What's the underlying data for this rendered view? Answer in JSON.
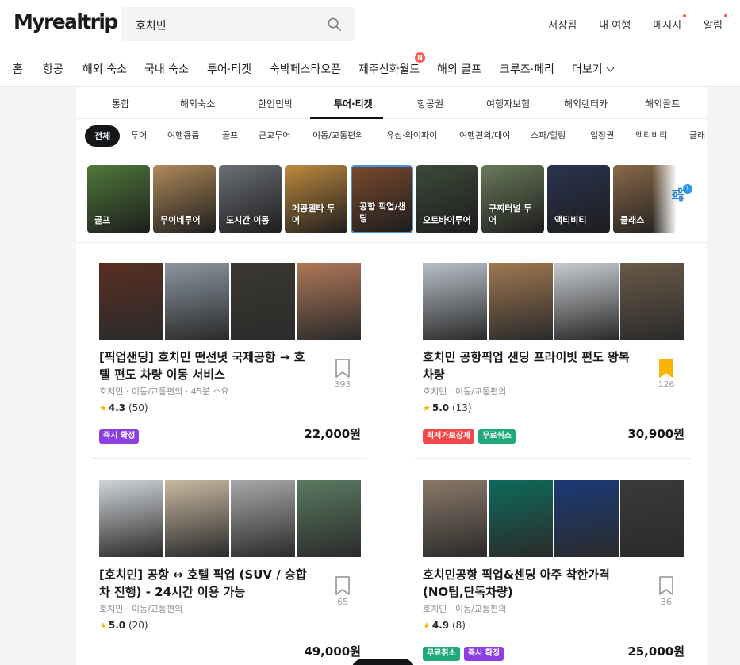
{
  "brand": {
    "logo": "Myrealtrip"
  },
  "search": {
    "value": "호치민"
  },
  "top_links": [
    {
      "label": "저장됨",
      "dot": false
    },
    {
      "label": "내 여행",
      "dot": false
    },
    {
      "label": "메시지",
      "dot": true
    },
    {
      "label": "알림",
      "dot": true
    }
  ],
  "main_nav": [
    {
      "label": "홈"
    },
    {
      "label": "항공"
    },
    {
      "label": "해외 숙소"
    },
    {
      "label": "국내 숙소"
    },
    {
      "label": "투어·티켓"
    },
    {
      "label": "숙박페스타오픈"
    },
    {
      "label": "제주신화월드",
      "badge": "N"
    },
    {
      "label": "해외 골프"
    },
    {
      "label": "크루즈·페리"
    },
    {
      "label": "더보기"
    }
  ],
  "category_tabs": [
    {
      "label": "통합"
    },
    {
      "label": "해외숙소"
    },
    {
      "label": "한인민박"
    },
    {
      "label": "투어·티켓",
      "active": true
    },
    {
      "label": "항공권"
    },
    {
      "label": "여행자보험"
    },
    {
      "label": "해외렌터카"
    },
    {
      "label": "해외골프"
    }
  ],
  "chips": [
    {
      "label": "전체",
      "active": true
    },
    {
      "label": "투어"
    },
    {
      "label": "여행용품"
    },
    {
      "label": "골프"
    },
    {
      "label": "근교투어"
    },
    {
      "label": "이동/교통편의"
    },
    {
      "label": "유심·와이파이"
    },
    {
      "label": "여행편의/대여"
    },
    {
      "label": "스파/힐링"
    },
    {
      "label": "입장권"
    },
    {
      "label": "액티비티"
    },
    {
      "label": "클래"
    }
  ],
  "thumbnails": [
    {
      "label": "골프",
      "color": "#4f7a3a"
    },
    {
      "label": "무이네투어",
      "color": "#b08a5a"
    },
    {
      "label": "도시간 이동",
      "color": "#6b6f75"
    },
    {
      "label": "메콩델타 투어",
      "color": "#c08a3e"
    },
    {
      "label": "공항 픽업/샌딩",
      "color": "#7a4a2e",
      "selected": true
    },
    {
      "label": "오토바이투어",
      "color": "#3d4a3a"
    },
    {
      "label": "구찌터널 투어",
      "color": "#6a7a5a"
    },
    {
      "label": "액티비티",
      "color": "#2a3450"
    },
    {
      "label": "클래스",
      "color": "#8a6a4a"
    }
  ],
  "filter": {
    "count": "1"
  },
  "products": [
    {
      "title": "[픽업샌딩] 호치민 떤선녓 국제공항 → 호텔 편도 차량 이동 서비스",
      "meta": "호치민 · 이동/교통편의 · 45분 소요",
      "rating": "4.3",
      "reviews": "(50)",
      "saved_count": "393",
      "saved": false,
      "badges": [
        {
          "label": "즉시 확정",
          "color": "#8b3fe0"
        }
      ],
      "price": "22,000원",
      "image_colors": [
        "#5a2e22",
        "#8a96a0",
        "#3a3830",
        "#b07858"
      ]
    },
    {
      "title": "호치민 공항픽업 샌딩 프라이빗 편도 왕복 차량",
      "meta": "호치민 · 이동/교통편의",
      "rating": "5.0",
      "reviews": "(13)",
      "saved_count": "126",
      "saved": true,
      "badges": [
        {
          "label": "최저가보장제",
          "color": "#f04848"
        },
        {
          "label": "무료취소",
          "color": "#1fa87a"
        }
      ],
      "price": "30,900원",
      "image_colors": [
        "#b8c0c8",
        "#a07850",
        "#c8ccd0",
        "#6a5a48"
      ]
    },
    {
      "title": "[호치민] 공항 ↔ 호텔 픽업 (SUV / 승합차 진행) - 24시간 이용 가능",
      "meta": "호치민 · 이동/교통편의",
      "rating": "5.0",
      "reviews": "(20)",
      "saved_count": "65",
      "saved": false,
      "badges": [],
      "price": "49,000원",
      "image_colors": [
        "#d0d4d8",
        "#c8b8a0",
        "#a8a8a8",
        "#5a7a60"
      ]
    },
    {
      "title": "호치민공항 픽업&센딩 아주 착한가격 (NO팁,단독차량)",
      "meta": "호치민 · 이동/교통편의",
      "rating": "4.9",
      "reviews": "(8)",
      "saved_count": "36",
      "saved": false,
      "badges": [
        {
          "label": "무료취소",
          "color": "#1fa87a"
        },
        {
          "label": "즉시 확정",
          "color": "#8b3fe0"
        }
      ],
      "price": "25,000원",
      "image_colors": [
        "#8a7868",
        "#0e6a5a",
        "#1a3a78",
        "#3a3a3a"
      ]
    }
  ]
}
